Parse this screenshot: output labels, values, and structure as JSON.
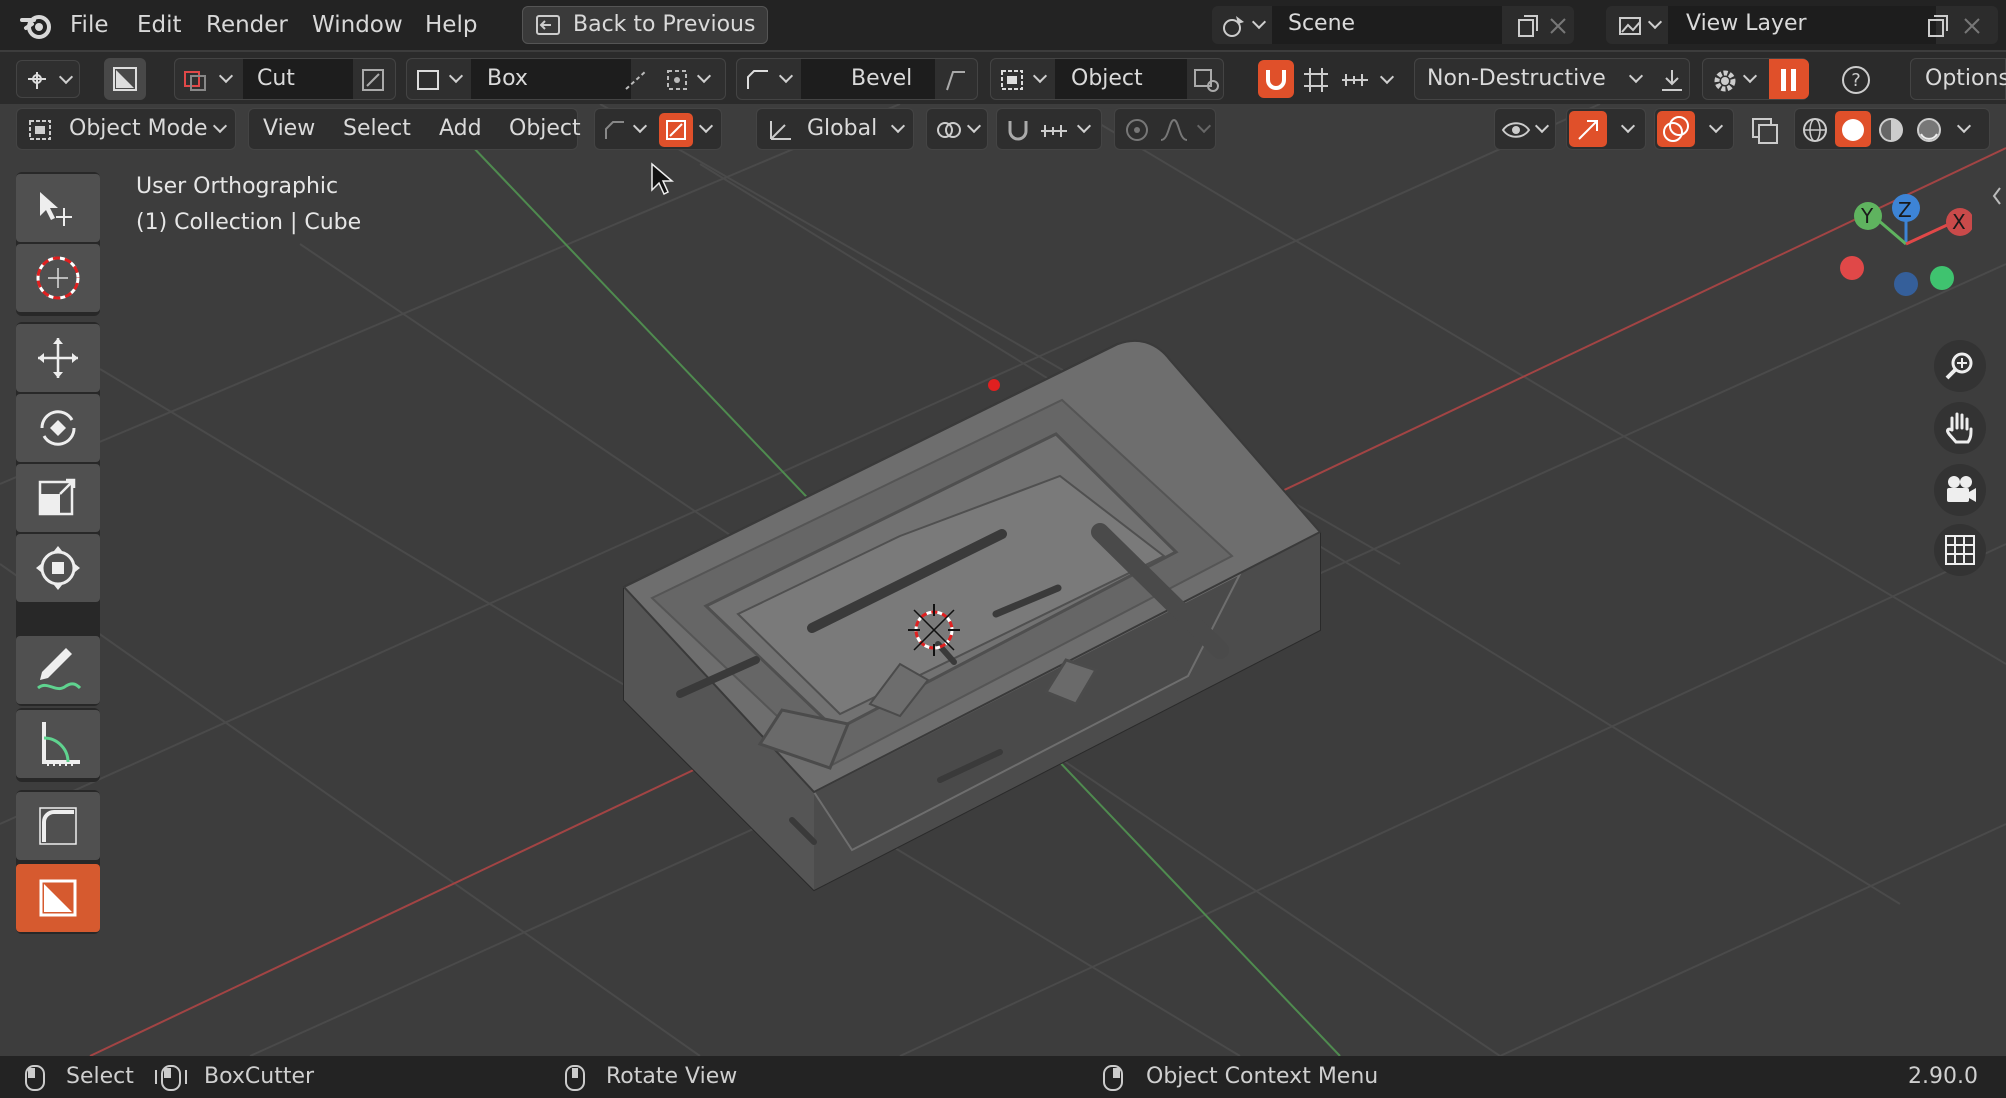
{
  "topbar": {
    "menus": [
      "File",
      "Edit",
      "Render",
      "Window",
      "Help"
    ],
    "back_button": "Back to Previous",
    "scene_name": "Scene",
    "view_layer": "View Layer"
  },
  "tool_settings": {
    "cut_mode": "Cut",
    "shape": "Box",
    "bevel": "Bevel",
    "alignment": "Object",
    "mode": "Non-Destructive",
    "options": "Options"
  },
  "header": {
    "mode": "Object Mode",
    "menus": [
      "View",
      "Select",
      "Add",
      "Object"
    ],
    "orientation": "Global"
  },
  "viewport": {
    "view_name": "User Orthographic",
    "collection_info": "(1) Collection | Cube",
    "gizmo_axes": [
      "Y",
      "Z",
      "X"
    ]
  },
  "statusbar": {
    "select": "Select",
    "boxcutter": "BoxCutter",
    "rotate": "Rotate View",
    "context_menu": "Object Context Menu",
    "version": "2.90.0"
  },
  "colors": {
    "accent": "#e0502a",
    "x_axis": "#e04848",
    "y_axis": "#5fb35f",
    "z_axis": "#3d84d6"
  }
}
